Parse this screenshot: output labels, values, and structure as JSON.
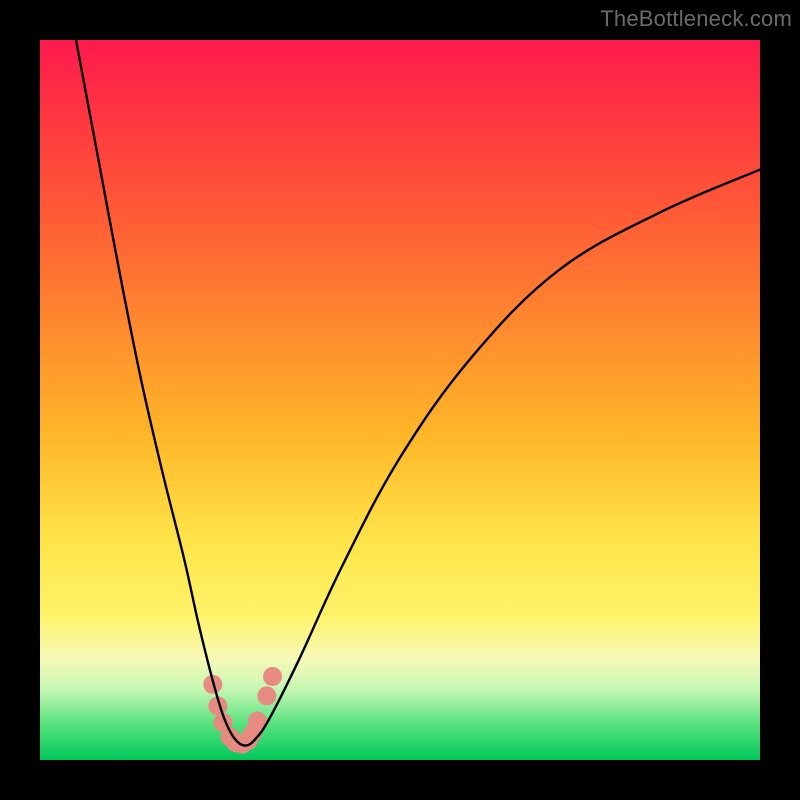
{
  "watermark": {
    "text": "TheBottleneck.com"
  },
  "chart_data": {
    "type": "line",
    "title": "",
    "xlabel": "",
    "ylabel": "",
    "xlim": [
      0,
      100
    ],
    "ylim": [
      0,
      100
    ],
    "series": [
      {
        "name": "curve",
        "x": [
          5,
          8,
          11,
          14,
          17,
          20,
          22,
          24,
          25.5,
          27,
          28.5,
          30,
          32,
          36,
          42,
          50,
          60,
          72,
          86,
          100
        ],
        "values": [
          100,
          84,
          68,
          53,
          40,
          28,
          19,
          11,
          6,
          3,
          2,
          3,
          6,
          14,
          27,
          42,
          56,
          68,
          76,
          82
        ]
      }
    ],
    "markers": [
      {
        "x": 24,
        "y": 10.5
      },
      {
        "x": 24.7,
        "y": 7.5
      },
      {
        "x": 25.4,
        "y": 5.2
      },
      {
        "x": 26.4,
        "y": 3.2
      },
      {
        "x": 27.2,
        "y": 2.4
      },
      {
        "x": 28.1,
        "y": 2.2
      },
      {
        "x": 28.9,
        "y": 2.7
      },
      {
        "x": 29.5,
        "y": 3.7
      },
      {
        "x": 30.2,
        "y": 5.4
      },
      {
        "x": 31.5,
        "y": 8.9
      },
      {
        "x": 32.3,
        "y": 11.6
      }
    ],
    "colors": {
      "curve": "#000000",
      "marker": "#e78a82"
    }
  }
}
